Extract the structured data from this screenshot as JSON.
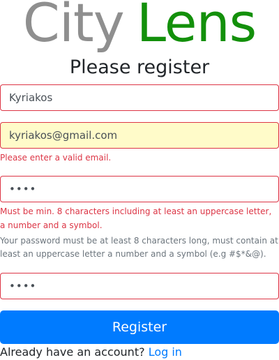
{
  "logo": {
    "part1": "City",
    "part2": "Lens"
  },
  "heading": "Please register",
  "form": {
    "username_value": "Kyriakos",
    "email_value": "kyriakos@gmail.com",
    "email_error": "Please enter a valid email.",
    "password_value": "••••",
    "password_error": "Must be min. 8 characters including at least an uppercase letter, a number and a symbol.",
    "password_help": "Your password must be at least 8 characters long, must contain at least an uppercase letter a number and a symbol (e.g #$*&@).",
    "confirm_value": "••••",
    "submit_label": "Register"
  },
  "footer": {
    "prompt": "Already have an account?",
    "login_link": "Log in"
  },
  "colors": {
    "logo_city": "#8f8f8f",
    "logo_lens": "#13900b",
    "error": "#dc3545",
    "primary": "#007bff",
    "autofill_bg": "#fffbc9"
  }
}
